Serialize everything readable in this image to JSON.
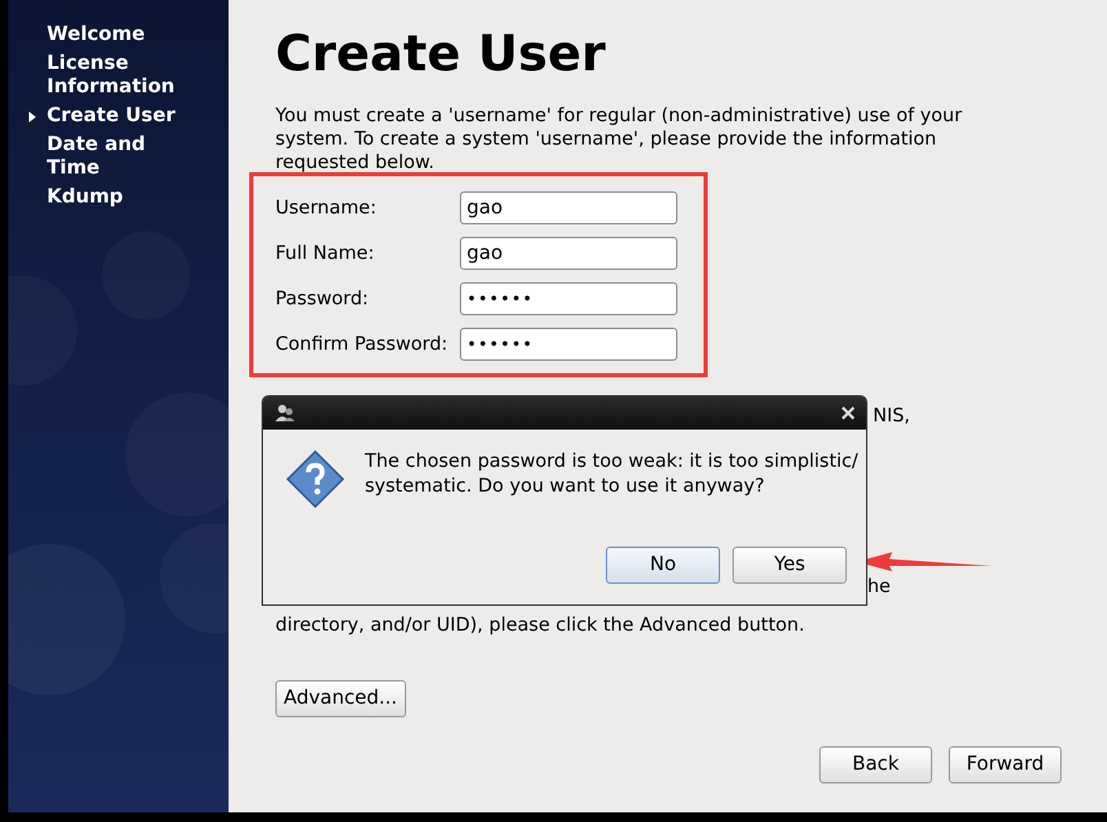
{
  "sidebar": {
    "items": [
      {
        "label": "Welcome",
        "selected": false
      },
      {
        "label": "License Information",
        "selected": false
      },
      {
        "label": "Create User",
        "selected": true
      },
      {
        "label": "Date and Time",
        "selected": false
      },
      {
        "label": "Kdump",
        "selected": false
      }
    ]
  },
  "page": {
    "title": "Create User",
    "intro": "You must create a 'username' for regular (non-administrative) use of your system.  To create a system 'username', please provide the information requested below.",
    "fields": [
      {
        "label": "Username:",
        "value": "gao",
        "kind": "text"
      },
      {
        "label": "Full Name:",
        "value": "gao",
        "kind": "text"
      },
      {
        "label": "Password:",
        "value": "••••••",
        "kind": "password"
      },
      {
        "label": "Confirm Password:",
        "value": "••••••",
        "kind": "password"
      }
    ],
    "partly_hidden_text": [
      "NIS,",
      "he"
    ],
    "advanced_note": "directory, and/or UID), please click the Advanced button.",
    "advanced_button": "Advanced...",
    "nav_buttons": [
      "Back",
      "Forward"
    ]
  },
  "dialog": {
    "message": "The chosen password is too weak: it is too simplistic/ systematic. Do you want to use it anyway?",
    "buttons": [
      {
        "label": "No",
        "focused": true
      },
      {
        "label": "Yes",
        "focused": false
      }
    ]
  },
  "annotations": {
    "highlight_box": true,
    "pointer_arrow": true
  }
}
